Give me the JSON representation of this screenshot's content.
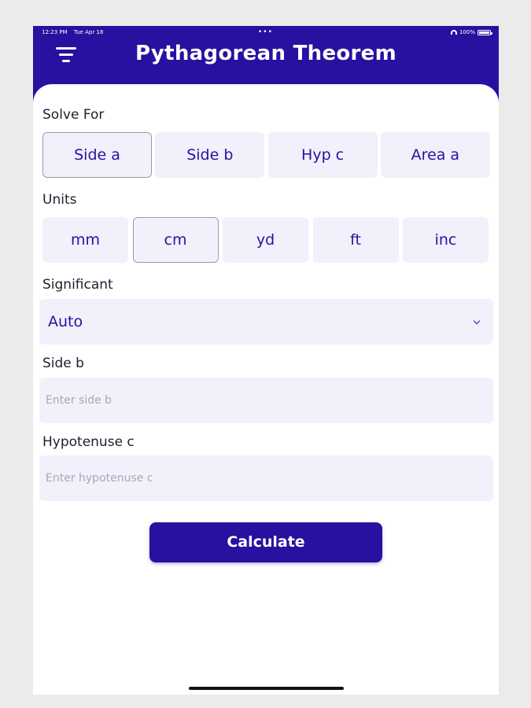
{
  "status_bar": {
    "time": "12:23 PM",
    "date": "Tue Apr 18",
    "dots": "•••",
    "battery": "100%"
  },
  "header": {
    "title": "Pythagorean Theorem"
  },
  "solve_for": {
    "label": "Solve For",
    "options": [
      "Side a",
      "Side b",
      "Hyp c",
      "Area a"
    ],
    "selected": "Side a"
  },
  "units": {
    "label": "Units",
    "options": [
      "mm",
      "cm",
      "yd",
      "ft",
      "inc"
    ],
    "selected": "cm"
  },
  "significant": {
    "label": "Significant",
    "value": "Auto"
  },
  "side_b": {
    "label": "Side b",
    "placeholder": "Enter side b"
  },
  "hypotenuse": {
    "label": "Hypotenuse c",
    "placeholder": "Enter hypotenuse c"
  },
  "calculate": {
    "label": "Calculate"
  },
  "colors": {
    "primary": "#2811a0",
    "field_bg": "#f1f0fb",
    "page_bg": "#ebebeb"
  }
}
